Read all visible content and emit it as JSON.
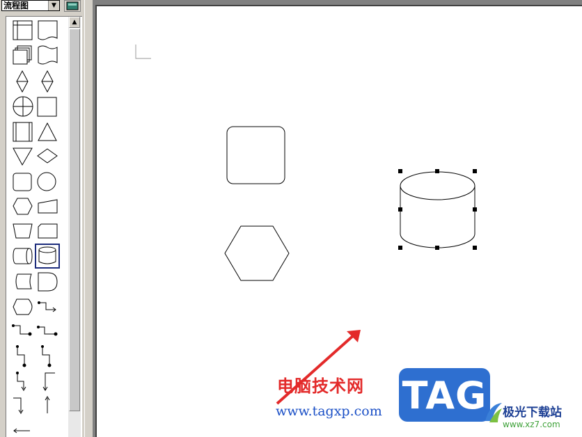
{
  "palette": {
    "category_select": {
      "value": "流程图",
      "icon": "chevron-down-icon"
    },
    "library_button": {
      "icon": "books-icon"
    },
    "scrollbar": {
      "up_icon": "triangle-up-icon"
    },
    "shapes": [
      "internal-storage-shape-icon",
      "document-shape-icon",
      "multi-document-shape-icon",
      "punched-tape-shape-icon",
      "collate-shape-icon",
      "sort-shape-icon",
      "summing-junction-shape-icon",
      "process-square-shape-icon",
      "predefined-process-shape-icon",
      "extract-triangle-shape-icon",
      "merge-triangle-shape-icon",
      "decision-diamond-shape-icon",
      "rounded-rect-shape-icon",
      "connector-circle-shape-icon",
      "preparation-hexagon-shape-icon",
      "manual-input-shape-icon",
      "manual-operation-shape-icon",
      "card-shape-icon",
      "direct-access-storage-shape-icon",
      "magnetic-disk-shape-icon",
      "stored-data-shape-icon",
      "delay-shape-icon",
      "display-shape-icon",
      "elbow-connector-icon",
      "elbow-connector-icon",
      "elbow-connector-icon",
      "elbow-connector-icon",
      "elbow-connector-icon",
      "elbow-connector-icon",
      "elbow-connector-icon",
      "elbow-connector-icon",
      "elbow-connector-icon",
      "arrow-left-connector-icon"
    ],
    "selected_shape": "magnetic-disk-shape-icon"
  },
  "canvas": {
    "shapes": [
      "rounded-rectangle",
      "hexagon",
      "cylinder"
    ],
    "selected_shape": "cylinder"
  },
  "watermark": {
    "site_name": "电脑技术网",
    "site_url": "www.tagxp.com",
    "logo_text": "TAG",
    "brand_name": "极光下载站",
    "brand_url": "www.xz7.com",
    "colors": {
      "red": "#e32a2a",
      "blue": "#2e6fd0",
      "green": "#3fa23a"
    }
  }
}
